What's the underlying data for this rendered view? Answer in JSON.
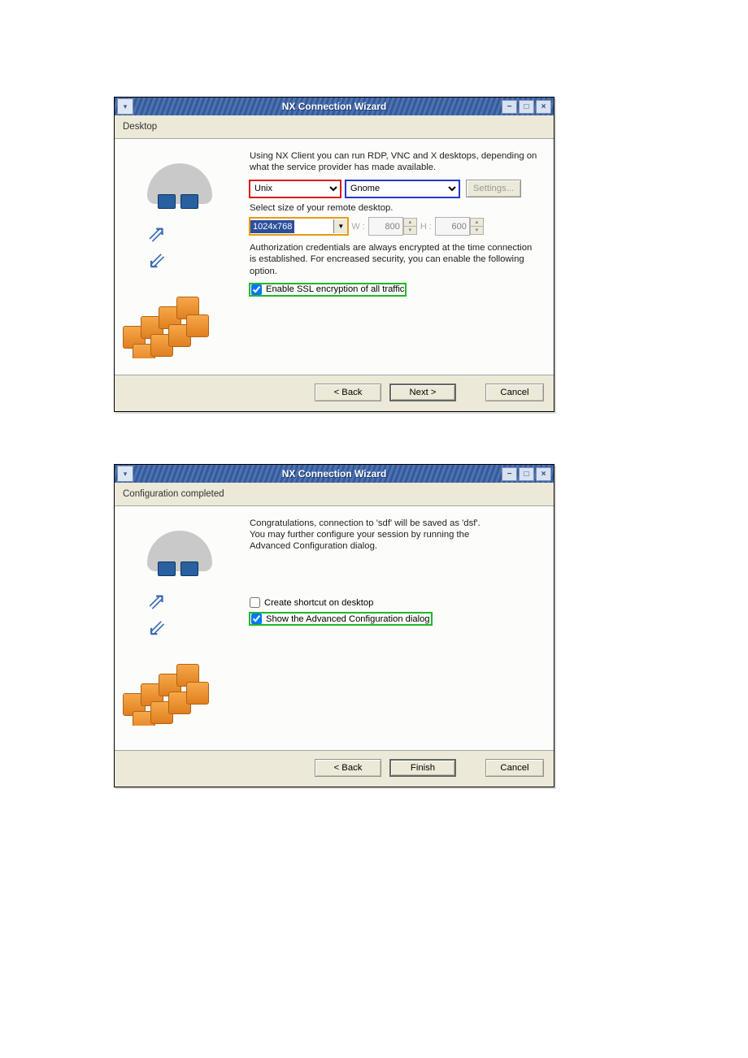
{
  "window_title": "NX Connection Wizard",
  "win1": {
    "section": "Desktop",
    "intro": "Using NX Client you can run RDP, VNC and X desktops, depending on what the service provider has made available.",
    "os_value": "Unix",
    "desktop_value": "Gnome",
    "settings_label": "Settings...",
    "size_label": "Select size of your remote desktop.",
    "resolution_value": "1024x768",
    "width_label": "W :",
    "width_value": "800",
    "height_label": "H :",
    "height_value": "600",
    "auth_text": "Authorization credentials are always encrypted at the time connection is established. For encreased security, you can enable the following option.",
    "ssl_label": "Enable SSL encryption of all traffic",
    "back_label": "< Back",
    "next_label": "Next >",
    "cancel_label": "Cancel"
  },
  "win2": {
    "section": "Configuration completed",
    "congrats": "Congratulations, connection to 'sdf' will be saved as 'dsf'. You may further configure your session by running the Advanced Configuration dialog.",
    "shortcut_label": "Create shortcut on desktop",
    "advanced_label": "Show the Advanced Configuration dialog",
    "back_label": "< Back",
    "finish_label": "Finish",
    "cancel_label": "Cancel"
  }
}
